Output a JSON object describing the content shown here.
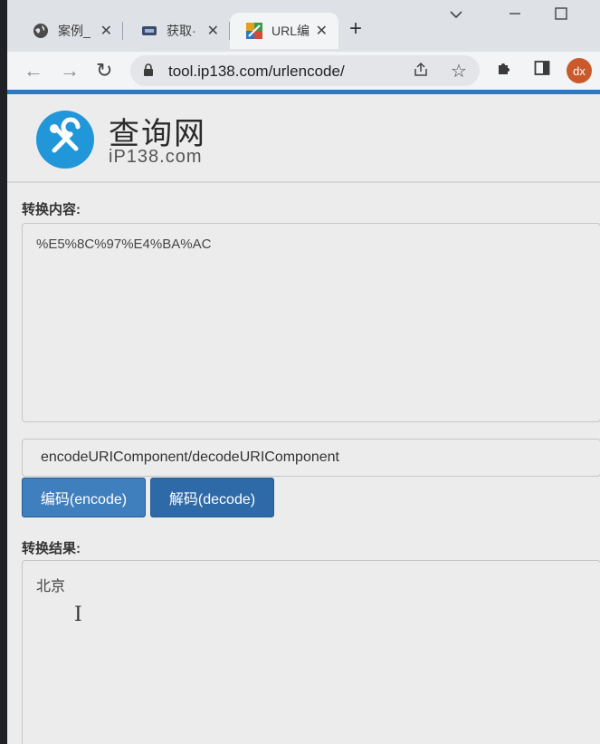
{
  "browser": {
    "tabs": [
      {
        "title": "案例_",
        "icon": "globe-icon"
      },
      {
        "title": "获取·",
        "icon": "page-icon"
      },
      {
        "title": "URL编",
        "icon": "ip138-favicon",
        "active": true
      }
    ],
    "url": "tool.ip138.com/urlencode/",
    "avatar_initials": "dx"
  },
  "site": {
    "title": "查询网",
    "subtitle": "iP138.com"
  },
  "form": {
    "input_label": "转换内容:",
    "input_value": "%E5%8C%97%E4%BA%AC",
    "method_value": "encodeURIComponent/decodeURIComponent",
    "encode_button": "编码(encode)",
    "decode_button": "解码(decode)",
    "output_label": "转换结果:",
    "output_value": "北京"
  },
  "colors": {
    "accent": "#2c78c2",
    "encode_button": "#3f7fbe",
    "decode_button": "#2e6aa8",
    "avatar": "#c95a2c"
  }
}
